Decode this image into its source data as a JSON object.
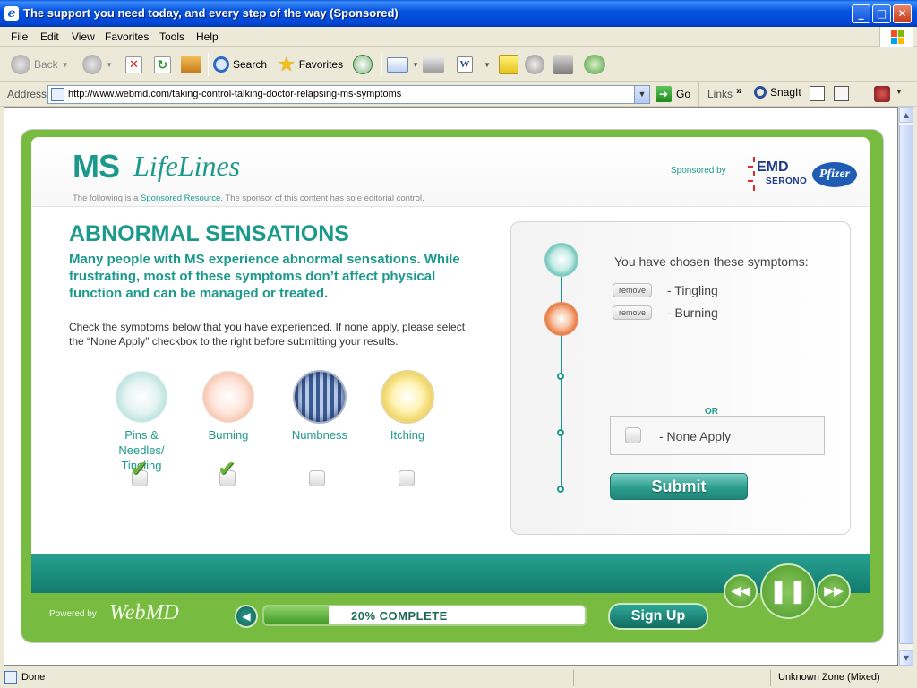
{
  "window": {
    "title": "The support you need today, and every step of the way (Sponsored)"
  },
  "menu": {
    "items": [
      "File",
      "Edit",
      "View",
      "Favorites",
      "Tools",
      "Help"
    ]
  },
  "toolbar": {
    "back_label": "Back",
    "search_label": "Search",
    "favorites_label": "Favorites"
  },
  "address": {
    "label": "Address",
    "url": "http://www.webmd.com/taking-control-talking-doctor-relapsing-ms-symptoms",
    "go_label": "Go",
    "links_label": "Links",
    "snagit_label": "SnagIt"
  },
  "status": {
    "text": "Done",
    "zone": "Unknown Zone (Mixed)"
  },
  "page": {
    "logo_ms": "MS",
    "logo_lifelines": "LifeLines",
    "disclaimer_pre": "The following is a ",
    "disclaimer_link": "Sponsored Resource.",
    "disclaimer_post": " The sponsor of this content has sole editorial control.",
    "sponsored_by": "Sponsored by",
    "emd_line1": "EMD",
    "emd_line2": "SERONO",
    "pfizer": "Pfizer",
    "heading": "ABNORMAL SENSATIONS",
    "lead": "Many people with MS experience abnormal sensations. While frustrating, most of these symptoms don’t affect physical function and can be managed or treated.",
    "instructions": "Check the symptoms below that you have experienced. If none apply, please select the “None Apply” checkbox to the right before submitting your results.",
    "symptoms": [
      {
        "label": "Pins & Needles/ Tingling",
        "checked": true,
        "icon": "pins-needles-icon"
      },
      {
        "label": "Burning",
        "checked": true,
        "icon": "burning-icon"
      },
      {
        "label": "Numbness",
        "checked": false,
        "icon": "numbness-icon"
      },
      {
        "label": "Itching",
        "checked": false,
        "icon": "itching-icon"
      }
    ],
    "chosen_title": "You have chosen these symptoms:",
    "remove_label": "remove",
    "chosen": [
      "-  Tingling",
      "-  Burning"
    ],
    "or_label": "OR",
    "none_apply_label": "-  None Apply",
    "submit_label": "Submit",
    "powered_by": "Powered by",
    "webmd": "WebMD",
    "progress_label": "20% COMPLETE",
    "progress_fraction": 0.2,
    "signup_label": "Sign Up"
  },
  "colors": {
    "accent": "#1b9a8c",
    "frame_green": "#77bb41",
    "title_blue": "#0454e0"
  }
}
